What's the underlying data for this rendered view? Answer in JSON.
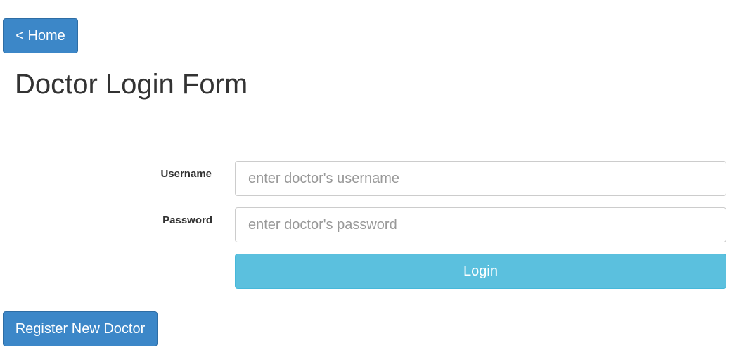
{
  "nav": {
    "home_label": "< Home"
  },
  "page": {
    "title": "Doctor Login Form"
  },
  "form": {
    "username": {
      "label": "Username",
      "value": "",
      "placeholder": "enter doctor's username"
    },
    "password": {
      "label": "Password",
      "value": "",
      "placeholder": "enter doctor's password"
    },
    "login_label": "Login"
  },
  "footer": {
    "register_label": "Register New Doctor"
  },
  "colors": {
    "primary": "#3c87c8",
    "info": "#5bc0de"
  }
}
